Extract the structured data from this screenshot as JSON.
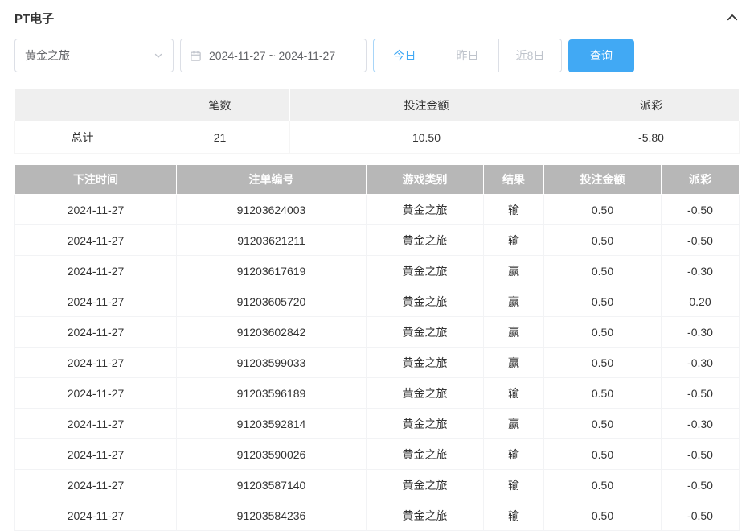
{
  "header": {
    "title": "PT电子"
  },
  "filters": {
    "game_select_value": "黄金之旅",
    "date_range_value": "2024-11-27 ~ 2024-11-27",
    "quick_labels": [
      "今日",
      "昨日",
      "近8日"
    ],
    "search_label": "查询"
  },
  "summary": {
    "headers": [
      "",
      "笔数",
      "投注金额",
      "派彩"
    ],
    "total_label": "总计",
    "count": "21",
    "bet_amount": "10.50",
    "payout": "-5.80"
  },
  "table": {
    "headers": [
      "下注时间",
      "注单编号",
      "游戏类别",
      "结果",
      "投注金额",
      "派彩"
    ],
    "rows": [
      {
        "date": "2024-11-27",
        "order_id": "91203624003",
        "game": "黄金之旅",
        "result": "输",
        "bet": "0.50",
        "payout": "-0.50"
      },
      {
        "date": "2024-11-27",
        "order_id": "91203621211",
        "game": "黄金之旅",
        "result": "输",
        "bet": "0.50",
        "payout": "-0.50"
      },
      {
        "date": "2024-11-27",
        "order_id": "91203617619",
        "game": "黄金之旅",
        "result": "赢",
        "bet": "0.50",
        "payout": "-0.30"
      },
      {
        "date": "2024-11-27",
        "order_id": "91203605720",
        "game": "黄金之旅",
        "result": "赢",
        "bet": "0.50",
        "payout": "0.20"
      },
      {
        "date": "2024-11-27",
        "order_id": "91203602842",
        "game": "黄金之旅",
        "result": "赢",
        "bet": "0.50",
        "payout": "-0.30"
      },
      {
        "date": "2024-11-27",
        "order_id": "91203599033",
        "game": "黄金之旅",
        "result": "赢",
        "bet": "0.50",
        "payout": "-0.30"
      },
      {
        "date": "2024-11-27",
        "order_id": "91203596189",
        "game": "黄金之旅",
        "result": "输",
        "bet": "0.50",
        "payout": "-0.50"
      },
      {
        "date": "2024-11-27",
        "order_id": "91203592814",
        "game": "黄金之旅",
        "result": "赢",
        "bet": "0.50",
        "payout": "-0.30"
      },
      {
        "date": "2024-11-27",
        "order_id": "91203590026",
        "game": "黄金之旅",
        "result": "输",
        "bet": "0.50",
        "payout": "-0.50"
      },
      {
        "date": "2024-11-27",
        "order_id": "91203587140",
        "game": "黄金之旅",
        "result": "输",
        "bet": "0.50",
        "payout": "-0.50"
      },
      {
        "date": "2024-11-27",
        "order_id": "91203584236",
        "game": "黄金之旅",
        "result": "输",
        "bet": "0.50",
        "payout": "-0.50"
      }
    ]
  },
  "colors": {
    "accent": "#41a9f4",
    "negative": "#e25252",
    "table_header_bg": "#b7b7b7",
    "summary_header_bg": "#efefef"
  }
}
